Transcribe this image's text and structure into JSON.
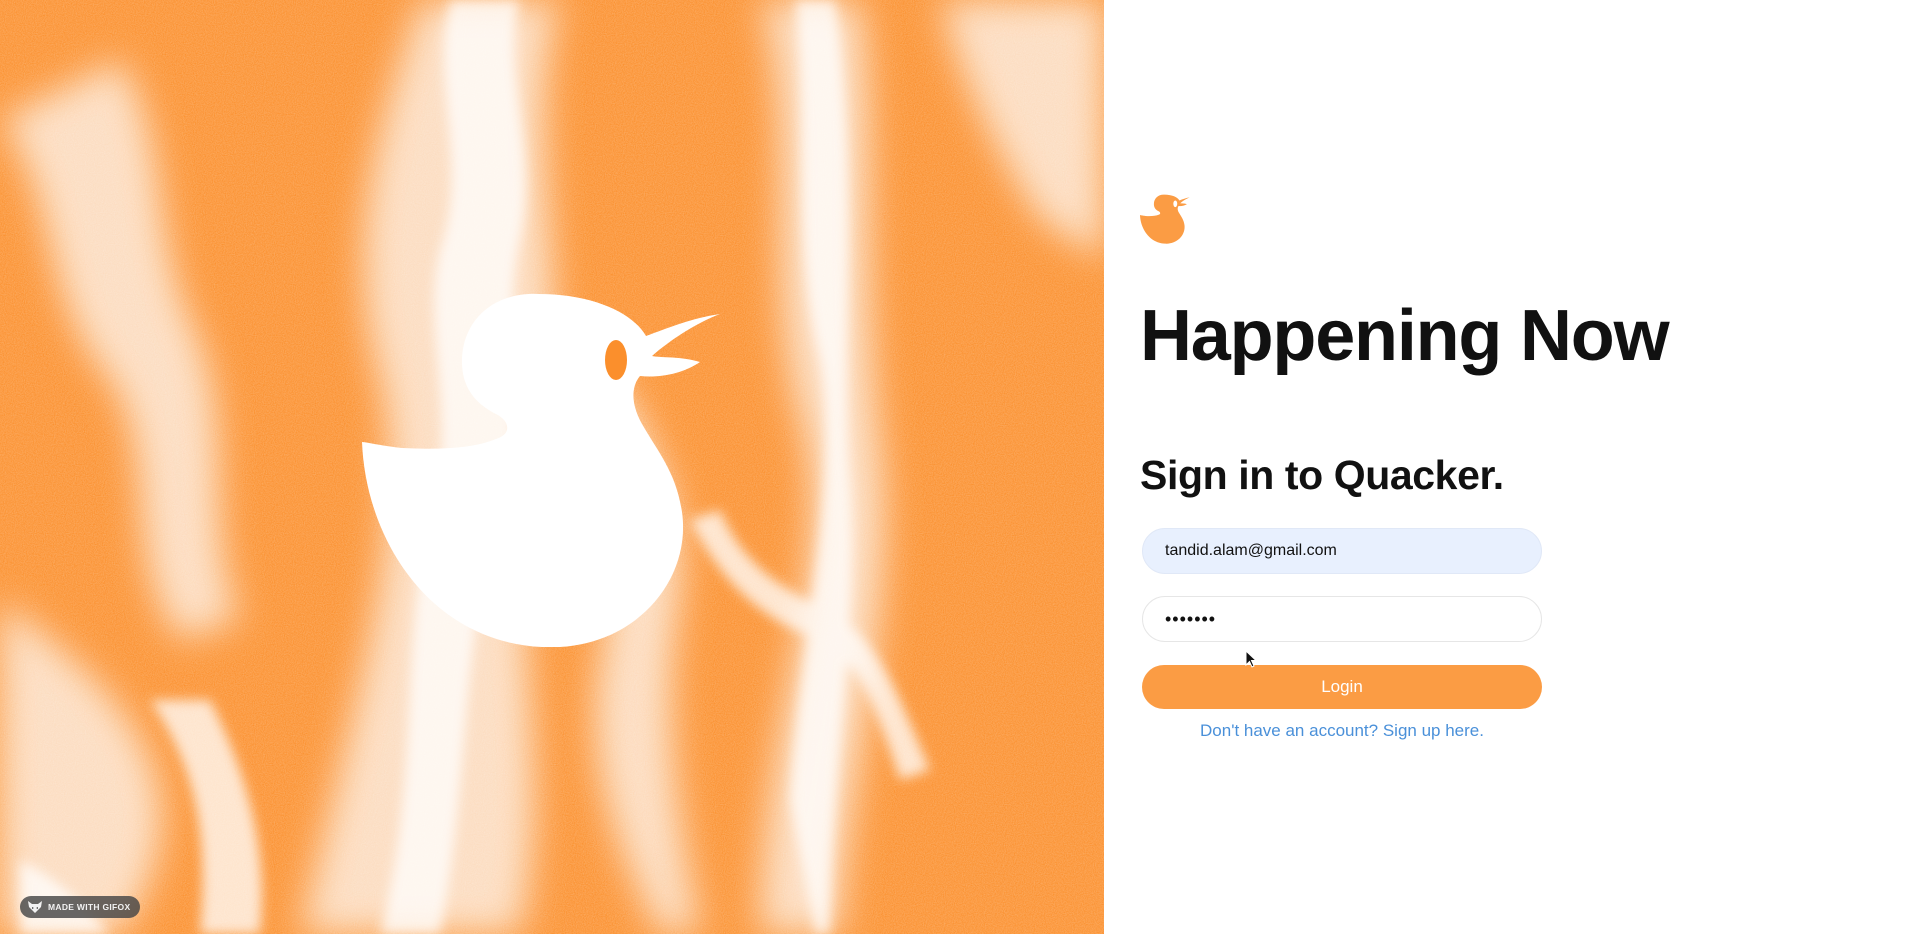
{
  "hero": {
    "badge_text": "MADE WITH GIFOX"
  },
  "login": {
    "headline": "Happening Now",
    "subheadline": "Sign in to Quacker.",
    "email_value": "tandid.alam@gmail.com",
    "password_value": "•••••••",
    "login_label": "Login",
    "signup_text": "Don't have an account? Sign up here."
  },
  "colors": {
    "brand_orange": "#fb923c",
    "button_orange": "#fb9c44",
    "link_blue": "#4a90d9",
    "autofill_blue": "#e8f0fe"
  },
  "icons": {
    "brand": "duck-icon",
    "hero": "duck-icon",
    "badge": "fox-icon",
    "cursor": "mouse-pointer-icon"
  }
}
